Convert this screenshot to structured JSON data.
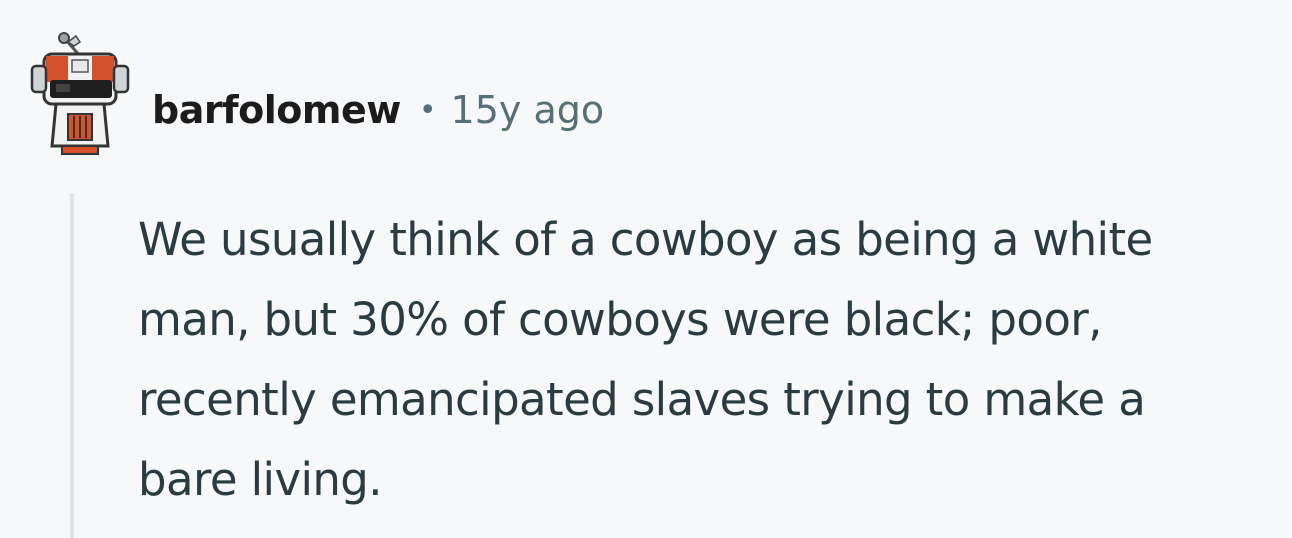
{
  "comment": {
    "author": "barfolomew",
    "separator": "•",
    "timestamp": "15y ago",
    "avatar_icon": "robot-snoo-avatar-icon",
    "body_lines": [
      "We usually think of a cowboy as being a white",
      "man, but 30% of cowboys were black; poor,",
      "recently emancipated slaves trying to make a",
      "bare living."
    ]
  },
  "colors": {
    "background": "#f7f8fa",
    "author": "#1c1c1c",
    "meta": "#576f76",
    "body_text": "#2a3c42",
    "thread_line": "#dfe3e7",
    "avatar_accent": "#d4512b"
  }
}
